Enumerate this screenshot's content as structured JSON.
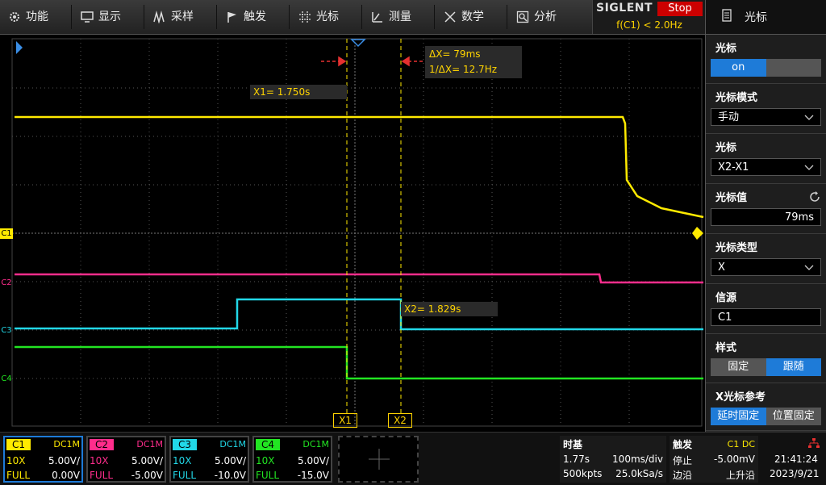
{
  "menu": {
    "items": [
      {
        "label": "功能",
        "icon": "gear-icon"
      },
      {
        "label": "显示",
        "icon": "monitor-icon"
      },
      {
        "label": "采样",
        "icon": "acquire-icon"
      },
      {
        "label": "触发",
        "icon": "flag-icon"
      },
      {
        "label": "光标",
        "icon": "crosshair-icon"
      },
      {
        "label": "测量",
        "icon": "measure-icon"
      },
      {
        "label": "数学",
        "icon": "math-icon"
      },
      {
        "label": "分析",
        "icon": "analysis-icon"
      }
    ]
  },
  "brand": {
    "name": "SIGLENT",
    "state": "Stop",
    "freq": "f(C1) < 2.0Hz"
  },
  "panel": {
    "title": "光标",
    "cursor_label": "光标",
    "on_label": "on",
    "mode_label": "光标模式",
    "mode_value": "手动",
    "cursor2_label": "光标",
    "cursor2_value": "X2-X1",
    "value_label": "光标值",
    "value": "79ms",
    "type_label": "光标类型",
    "type_value": "X",
    "source_label": "信源",
    "source_value": "C1",
    "style_label": "样式",
    "style_fixed": "固定",
    "style_follow": "跟随",
    "xref_label": "X光标参考",
    "xref_delay": "延时固定",
    "xref_pos": "位置固定"
  },
  "screen": {
    "dx_label": "ΔX= 79ms",
    "inv_dx_label": "1/ΔX= 12.7Hz",
    "x1_label": "X1= 1.750s",
    "x2_label": "X2= 1.829s",
    "x1_tag": "X1",
    "x2_tag": "X2",
    "ch_markers": [
      "C1",
      "C2",
      "C3",
      "C4"
    ]
  },
  "channels": [
    {
      "name": "C1",
      "coupling": "DC1M",
      "probe": "10X",
      "scale": "5.00V/",
      "bw": "FULL",
      "offset": "0.00V",
      "color": "#ffea00"
    },
    {
      "name": "C2",
      "coupling": "DC1M",
      "probe": "10X",
      "scale": "5.00V/",
      "bw": "FULL",
      "offset": "-5.00V",
      "color": "#ff2d8c"
    },
    {
      "name": "C3",
      "coupling": "DC1M",
      "probe": "10X",
      "scale": "5.00V/",
      "bw": "FULL",
      "offset": "-10.0V",
      "color": "#22d8e8"
    },
    {
      "name": "C4",
      "coupling": "DC1M",
      "probe": "10X",
      "scale": "5.00V/",
      "bw": "FULL",
      "offset": "-15.0V",
      "color": "#22e522"
    }
  ],
  "timebase": {
    "title": "时基",
    "delay": "1.77s",
    "scale": "100ms/div",
    "points": "500kpts",
    "rate": "25.0kSa/s"
  },
  "trigger": {
    "title": "触发",
    "source": "C1 DC",
    "mode": "停止",
    "level": "-5.00mV",
    "type": "边沿",
    "slope": "上升沿"
  },
  "clock": {
    "time": "21:41:24",
    "date": "2023/9/21"
  },
  "colors": {
    "c1": "#ffea00",
    "c2": "#ff2d8c",
    "c3": "#22d8e8",
    "c4": "#22e522",
    "accent": "#1e7bd8",
    "stop": "#cc0000"
  }
}
